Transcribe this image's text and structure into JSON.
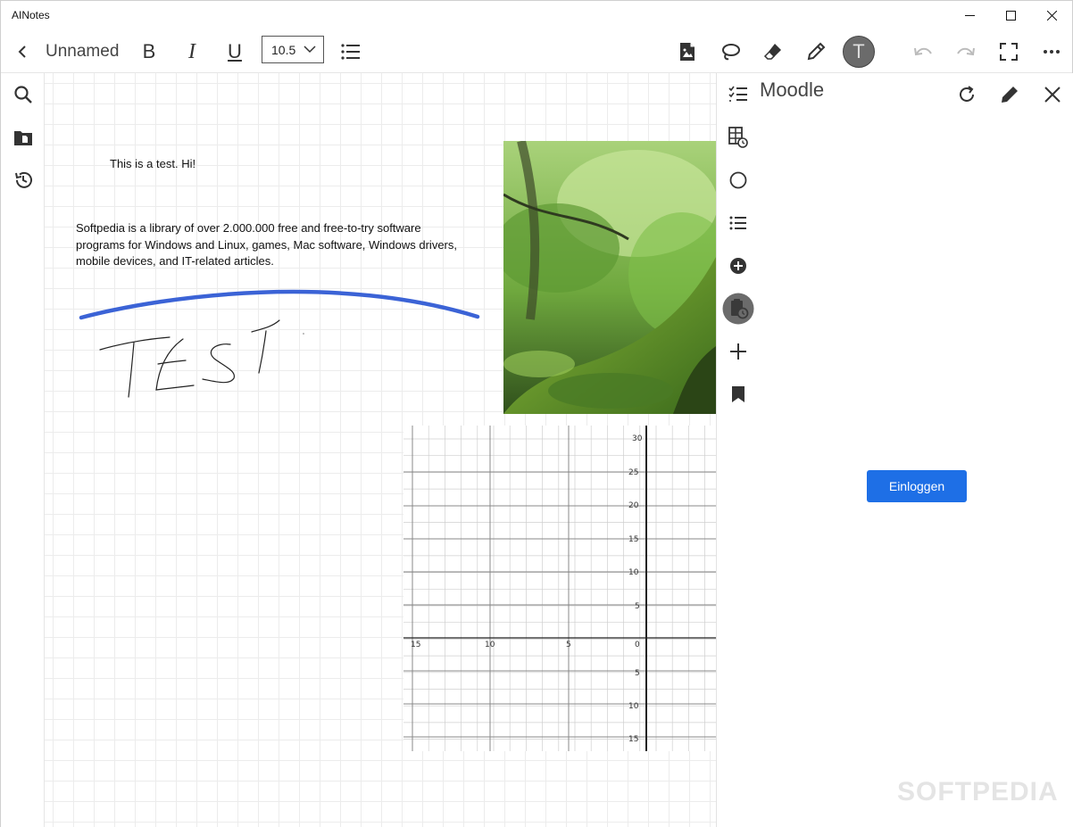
{
  "window": {
    "app_title": "AINotes"
  },
  "toolbar": {
    "back_icon": "chevron-left-icon",
    "doc_title": "Unnamed",
    "bold_label": "B",
    "italic_label": "I",
    "underline_label": "U",
    "font_size": "10.5",
    "list_icon": "bulleted-list-icon",
    "insert_image_icon": "image-file-icon",
    "lasso_icon": "lasso-icon",
    "eraser_icon": "eraser-icon",
    "pen_icon": "pen-icon",
    "text_tool_label": "T",
    "undo_icon": "undo-icon",
    "redo_icon": "redo-icon",
    "fullscreen_icon": "fullscreen-icon",
    "more_icon": "more-icon"
  },
  "left_rail": [
    "search-icon",
    "file-explorer-icon",
    "history-icon"
  ],
  "canvas": {
    "text_box_1": "This is a test. Hi!",
    "text_box_2_lines": [
      "Softpedia is a library of over 2.000.000 free and free-to-try software",
      "programs for Windows and Linux, games, Mac software, Windows drivers,",
      "mobile devices, and IT-related articles."
    ],
    "handwriting": "TEST",
    "graph": {
      "y_ticks": [
        "30",
        "25",
        "20",
        "15",
        "10",
        "5",
        "5",
        "10",
        "15"
      ],
      "x_ticks": [
        "15",
        "10",
        "5",
        "0"
      ]
    }
  },
  "side_panel": {
    "title": "Moodle",
    "login_label": "Einloggen",
    "icons": [
      "checklist-icon",
      "schedule-table-icon",
      "circle-icon",
      "list-icon",
      "add-circle-icon",
      "clipboard-clock-icon",
      "plus-icon",
      "bookmark-icon"
    ]
  },
  "watermark": "SOFTPEDIA",
  "colors": {
    "accent": "#1e6fe6",
    "stroke_blue": "#3b63d6",
    "avatar": "#6b6b6b"
  }
}
